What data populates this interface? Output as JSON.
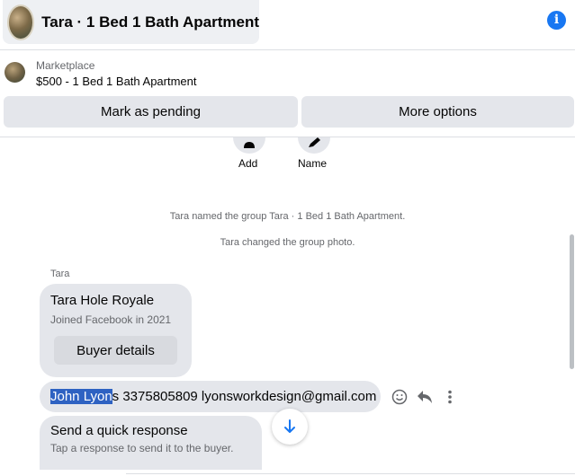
{
  "header": {
    "title": "Tara · 1 Bed 1 Bath Apartment",
    "info_icon": "info-icon",
    "info_glyph": "i"
  },
  "marketplace": {
    "label": "Marketplace",
    "item": "$500 - 1 Bed 1 Bath Apartment",
    "mark_pending_label": "Mark as pending",
    "more_options_label": "More options"
  },
  "chat_actions": {
    "add_label": "Add",
    "name_label": "Name"
  },
  "system_messages": [
    "Tara named the group Tara · 1 Bed 1 Bath Apartment.",
    "Tara changed the group photo."
  ],
  "buyer_card": {
    "sender": "Tara",
    "name": "Tara Hole Royale",
    "joined": "Joined Facebook in 2021",
    "button_label": "Buyer details"
  },
  "message": {
    "highlighted": "John Lyon",
    "rest": "s 3375805809 lyonsworkdesign@gmail.com",
    "tools": [
      "smiley-icon",
      "reply-icon",
      "more-vertical-icon"
    ]
  },
  "quick_response": {
    "title": "Send a quick response",
    "subtitle": "Tap a response to send it to the buyer."
  },
  "colors": {
    "accent": "#1877f2",
    "bubble": "#e4e6eb",
    "highlight": "#2e62c2",
    "secondary_text": "#65676b"
  }
}
